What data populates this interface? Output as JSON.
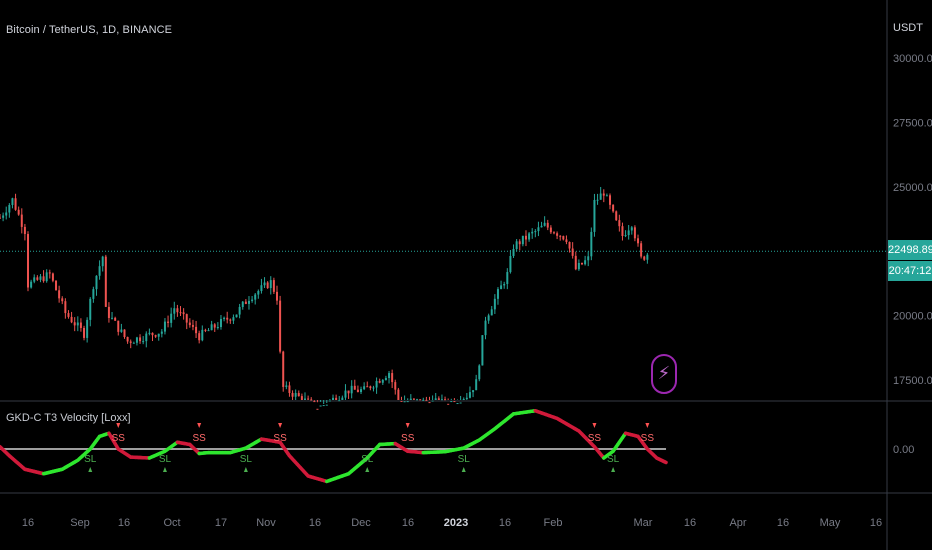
{
  "symbol_title": "Bitcoin / TetherUS, 1D, BINANCE",
  "indicator_title": "GKD-C T3 Velocity [Loxx]",
  "currency": "USDT",
  "colors": {
    "background": "#000000",
    "candle_up": "#26a69a",
    "candle_down": "#ef5350",
    "signal_up": "#2ee62e",
    "signal_down": "#d01a3a",
    "zero_line": "#9e9e9e",
    "price_tag": "#26a69a",
    "alert_icon": "#9c27b0"
  },
  "last_price_tag": {
    "price": "22498.89",
    "countdown": "20:47:12"
  },
  "alert_icon": "lightning-bolt-icon",
  "chart_data": [
    {
      "type": "candlestick",
      "title": "Bitcoin / TetherUS, 1D, BINANCE",
      "y_ticks": [
        "30000.00",
        "27500.00",
        "25000.00",
        "22500.00",
        "20000.00",
        "17500.00"
      ],
      "ylim": [
        16800,
        30400
      ],
      "last_price": 22498.89,
      "x_ticks": [
        "16",
        "Sep",
        "16",
        "Oct",
        "17",
        "Nov",
        "16",
        "Dec",
        "16",
        "2023",
        "16",
        "Feb",
        "Mar",
        "16",
        "Apr",
        "16",
        "May",
        "16"
      ],
      "x_range": [
        "2022-08-10",
        "2023-05-22"
      ],
      "close_path": [
        [
          "2022-08-10",
          23800
        ],
        [
          "2022-08-14",
          24500
        ],
        [
          "2022-08-15",
          24200
        ],
        [
          "2022-08-18",
          23300
        ],
        [
          "2022-08-19",
          21200
        ],
        [
          "2022-08-26",
          21600
        ],
        [
          "2022-08-31",
          20100
        ],
        [
          "2022-09-06",
          19300
        ],
        [
          "2022-09-09",
          21200
        ],
        [
          "2022-09-12",
          22300
        ],
        [
          "2022-09-13",
          20200
        ],
        [
          "2022-09-20",
          19000
        ],
        [
          "2022-10-01",
          19400
        ],
        [
          "2022-10-05",
          20300
        ],
        [
          "2022-10-13",
          19200
        ],
        [
          "2022-10-25",
          20100
        ],
        [
          "2022-10-29",
          20700
        ],
        [
          "2022-11-05",
          21300
        ],
        [
          "2022-11-07",
          20700
        ],
        [
          "2022-11-08",
          18500
        ],
        [
          "2022-11-09",
          17200
        ],
        [
          "2022-11-20",
          16400
        ],
        [
          "2022-11-30",
          17100
        ],
        [
          "2022-12-05",
          17100
        ],
        [
          "2022-12-13",
          17800
        ],
        [
          "2022-12-16",
          16700
        ],
        [
          "2023-01-01",
          16600
        ],
        [
          "2023-01-07",
          16900
        ],
        [
          "2023-01-10",
          17400
        ],
        [
          "2023-01-13",
          19900
        ],
        [
          "2023-01-20",
          21600
        ],
        [
          "2023-01-22",
          22700
        ],
        [
          "2023-02-01",
          23500
        ],
        [
          "2023-02-08",
          23000
        ],
        [
          "2023-02-11",
          21800
        ],
        [
          "2023-02-15",
          22200
        ],
        [
          "2023-02-17",
          24400
        ],
        [
          "2023-02-20",
          24800
        ],
        [
          "2023-02-24",
          23600
        ],
        [
          "2023-02-26",
          23100
        ],
        [
          "2023-03-01",
          23600
        ],
        [
          "2023-03-04",
          22200
        ],
        [
          "2023-03-06",
          22400
        ]
      ]
    },
    {
      "type": "line",
      "title": "GKD-C T3 Velocity [Loxx]",
      "y_ticks": [
        "0.00"
      ],
      "ylim": [
        -1,
        1
      ],
      "zero_line": 0,
      "velocity_path": [
        [
          "2022-08-10",
          0.05
        ],
        [
          "2022-08-13",
          -0.15
        ],
        [
          "2022-08-18",
          -0.45
        ],
        [
          "2022-08-24",
          -0.55
        ],
        [
          "2022-08-30",
          -0.45
        ],
        [
          "2022-09-04",
          -0.25
        ],
        [
          "2022-09-08",
          0.0
        ],
        [
          "2022-09-11",
          0.28
        ],
        [
          "2022-09-14",
          0.35
        ],
        [
          "2022-09-17",
          0.0
        ],
        [
          "2022-09-21",
          -0.18
        ],
        [
          "2022-09-27",
          -0.2
        ],
        [
          "2022-10-02",
          -0.05
        ],
        [
          "2022-10-06",
          0.15
        ],
        [
          "2022-10-10",
          0.1
        ],
        [
          "2022-10-13",
          -0.1
        ],
        [
          "2022-10-16",
          -0.08
        ],
        [
          "2022-10-23",
          -0.08
        ],
        [
          "2022-10-28",
          0.02
        ],
        [
          "2022-11-02",
          0.22
        ],
        [
          "2022-11-08",
          0.15
        ],
        [
          "2022-11-11",
          -0.15
        ],
        [
          "2022-11-17",
          -0.6
        ],
        [
          "2022-11-23",
          -0.72
        ],
        [
          "2022-11-30",
          -0.55
        ],
        [
          "2022-12-06",
          -0.2
        ],
        [
          "2022-12-10",
          0.1
        ],
        [
          "2022-12-15",
          0.12
        ],
        [
          "2022-12-19",
          -0.05
        ],
        [
          "2022-12-24",
          -0.08
        ],
        [
          "2022-12-31",
          -0.06
        ],
        [
          "2023-01-06",
          0.02
        ],
        [
          "2023-01-11",
          0.2
        ],
        [
          "2023-01-16",
          0.45
        ],
        [
          "2023-01-22",
          0.78
        ],
        [
          "2023-01-29",
          0.85
        ],
        [
          "2023-02-05",
          0.68
        ],
        [
          "2023-02-12",
          0.4
        ],
        [
          "2023-02-17",
          0.05
        ],
        [
          "2023-02-20",
          -0.2
        ],
        [
          "2023-02-23",
          -0.05
        ],
        [
          "2023-02-27",
          0.35
        ],
        [
          "2023-03-03",
          0.28
        ],
        [
          "2023-03-06",
          0.0
        ],
        [
          "2023-03-09",
          -0.2
        ],
        [
          "2023-03-12",
          -0.3
        ]
      ],
      "markers": [
        {
          "kind": "SS",
          "date": "2022-09-17"
        },
        {
          "kind": "SL",
          "date": "2022-09-08"
        },
        {
          "kind": "SL",
          "date": "2022-10-02"
        },
        {
          "kind": "SS",
          "date": "2022-10-13"
        },
        {
          "kind": "SL",
          "date": "2022-10-28"
        },
        {
          "kind": "SS",
          "date": "2022-11-08"
        },
        {
          "kind": "SL",
          "date": "2022-12-06"
        },
        {
          "kind": "SS",
          "date": "2022-12-19"
        },
        {
          "kind": "SL",
          "date": "2023-01-06"
        },
        {
          "kind": "SS",
          "date": "2023-02-17"
        },
        {
          "kind": "SL",
          "date": "2023-02-23"
        },
        {
          "kind": "SS",
          "date": "2023-03-06"
        }
      ]
    }
  ]
}
